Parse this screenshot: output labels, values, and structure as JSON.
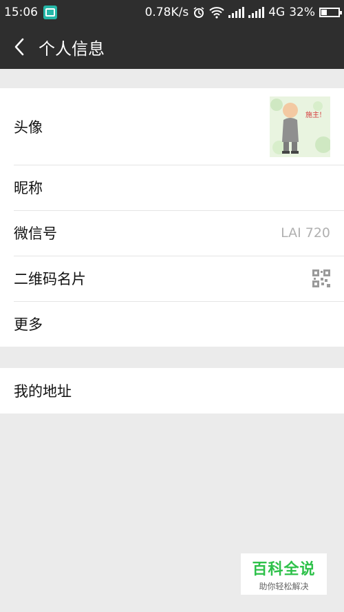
{
  "status_bar": {
    "time": "15:06",
    "net_speed": "0.78K/s",
    "network": "4G",
    "battery": "32%",
    "battery_level": 0.32,
    "icons": [
      "screenshot-app-icon",
      "alarm-icon",
      "wifi-icon",
      "signal-icon",
      "signal-icon",
      "battery-icon"
    ]
  },
  "nav": {
    "title": "个人信息",
    "back_icon": "chevron-left-icon"
  },
  "profile_items": [
    {
      "label": "头像"
    },
    {
      "label": "昵称",
      "value": ""
    },
    {
      "label": "微信号",
      "value": "LAI  720"
    },
    {
      "label": "二维码名片",
      "icon": "qr-code-icon"
    },
    {
      "label": "更多"
    }
  ],
  "address_items": [
    {
      "label": "我的地址"
    }
  ],
  "avatar": {
    "caption": "施主!"
  },
  "watermark": {
    "title": "百科全说",
    "subtitle": "助你轻松解决"
  },
  "colors": {
    "bar": "#2e2e2e",
    "background": "#ebebeb",
    "watermark_green": "#2ec14a"
  }
}
